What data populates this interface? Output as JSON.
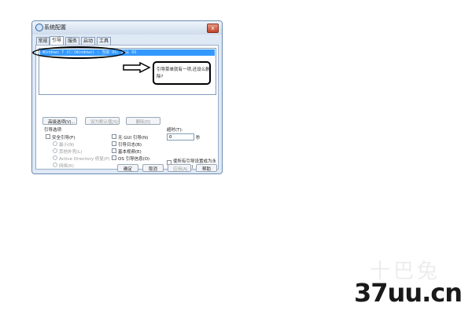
{
  "window": {
    "title": "系统配置",
    "close_label": "x"
  },
  "tabs": [
    {
      "label": "常规",
      "active": false
    },
    {
      "label": "引导",
      "active": true
    },
    {
      "label": "服务",
      "active": false
    },
    {
      "label": "启动",
      "active": false
    },
    {
      "label": "工具",
      "active": false
    }
  ],
  "os_list": {
    "selected_entry": "Windows 7 (C:\\Windows) : 当前 OS; 默认 OS"
  },
  "callout": {
    "text": "引导菜单就有一项,还设么删除?"
  },
  "buttons": {
    "advanced": "高级选项(V)...",
    "set_default": "设为默认值(S)",
    "delete": "删除(D)",
    "ok": "确定",
    "cancel": "取消",
    "apply": "应用(A)",
    "help": "帮助"
  },
  "boot_options": {
    "heading": "引导选项",
    "safe_boot": "安全引导(F)",
    "minimal": "最小(N)",
    "alternate_shell": "其他外壳(L)",
    "ad_repair": "Active Directory 修复(P)",
    "network": "网络(K)",
    "no_gui": "无 GUI 引导(N)",
    "boot_log": "引导日志(B)",
    "base_video": "基本视频(E)",
    "os_info": "OS 引导信息(O)"
  },
  "timeout": {
    "label": "超时(T):",
    "value": "0",
    "unit": "秒"
  },
  "permanent": {
    "label": "使所有引导设置成为永久设置(M)"
  },
  "watermark": {
    "faint": "十巴兔",
    "brand": "37uu.cn"
  }
}
